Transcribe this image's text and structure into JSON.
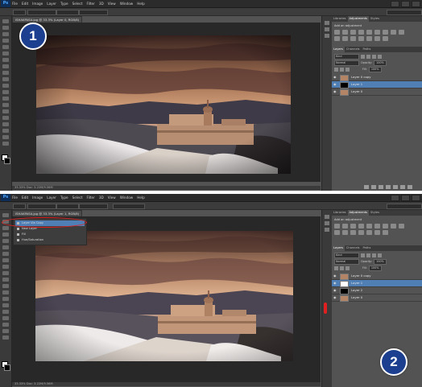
{
  "colors": {
    "accent_blue": "#1d3f8f",
    "selection": "#4f7fb4",
    "highlight_red": "#e02020"
  },
  "badges": {
    "one": "1",
    "two": "2"
  },
  "app": {
    "logo": "Ps",
    "menus": [
      "File",
      "Edit",
      "Image",
      "Layer",
      "Type",
      "Select",
      "Filter",
      "3D",
      "View",
      "Window",
      "Help"
    ]
  },
  "top": {
    "doc_tab": "ISHAKPASA.jpg @ 33.3% (Layer 0, RGB/8)",
    "status": "33.33%   Doc: 3.22M/9.56M",
    "panel_tabs": [
      "Libraries",
      "Adjustments",
      "Styles"
    ],
    "add_adjustment": "Add an adjustment",
    "layers_tabs": [
      "Layers",
      "Channels",
      "Paths"
    ],
    "kind": "Kind",
    "blend": "Normal",
    "opacity_label": "Opacity:",
    "opacity": "100%",
    "fill_label": "Fill:",
    "fill": "100%",
    "layers": [
      "Layer 0 copy",
      "Layer 1",
      "Layer 0"
    ]
  },
  "bottom": {
    "doc_tab": "ISHAKPASA.jpg @ 33.3% (Layer 1, RGB/8)",
    "status": "33.33%   Doc: 3.22M/9.56M",
    "history_rows": [
      "Layer Via Copy",
      "New Layer",
      "Fill",
      "Hue/Saturation"
    ],
    "panel_tabs": [
      "Libraries",
      "Adjustments",
      "Styles"
    ],
    "add_adjustment": "Add an adjustment",
    "layers_tabs": [
      "Layers",
      "Channels",
      "Paths"
    ],
    "kind": "Kind",
    "blend": "Normal",
    "opacity_label": "Opacity:",
    "opacity": "100%",
    "fill_label": "Fill:",
    "fill": "100%",
    "layers": [
      "Layer 0 copy",
      "Layer 1",
      "Layer 2",
      "Layer 0"
    ]
  }
}
